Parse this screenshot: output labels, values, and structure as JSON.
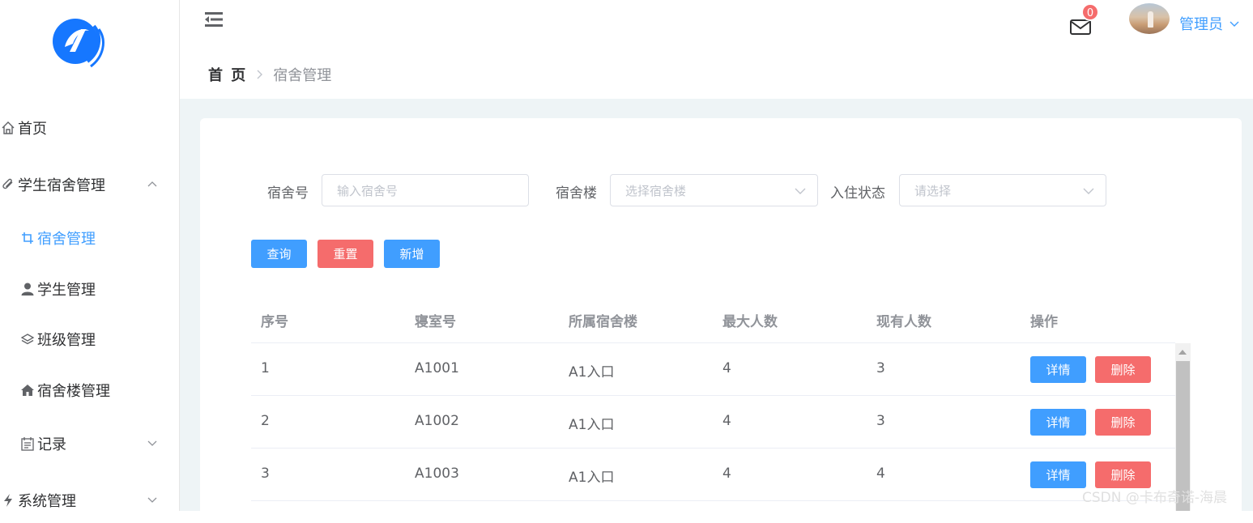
{
  "sidebar": {
    "items": [
      {
        "label": "首页",
        "icon": "home-icon"
      },
      {
        "label": "学生宿舍管理",
        "icon": "paperclip-icon",
        "expanded": true
      },
      {
        "label": "宿舍管理",
        "icon": "crop-icon",
        "active": true
      },
      {
        "label": "学生管理",
        "icon": "user-icon"
      },
      {
        "label": "班级管理",
        "icon": "layers-icon"
      },
      {
        "label": "宿舍楼管理",
        "icon": "house-icon"
      },
      {
        "label": "记录",
        "icon": "calendar-icon",
        "expanded": false
      },
      {
        "label": "系统管理",
        "icon": "lightning-icon",
        "expanded": false
      }
    ]
  },
  "header": {
    "mail_count": "0",
    "user_name": "管理员",
    "breadcrumb": {
      "home": "首 页",
      "current": "宿舍管理"
    }
  },
  "filters": {
    "room_label": "宿舍号",
    "room_placeholder": "输入宿舍号",
    "building_label": "宿舍楼",
    "building_placeholder": "选择宿舍楼",
    "status_label": "入住状态",
    "status_placeholder": "请选择"
  },
  "actions": {
    "query": "查询",
    "reset": "重置",
    "add": "新增"
  },
  "table": {
    "headers": [
      "序号",
      "寝室号",
      "所属宿舍楼",
      "最大人数",
      "现有人数",
      "操作"
    ],
    "rows": [
      {
        "index": "1",
        "room": "A1001",
        "building": "A1入口",
        "max": "4",
        "current": "3"
      },
      {
        "index": "2",
        "room": "A1002",
        "building": "A1入口",
        "max": "4",
        "current": "3"
      },
      {
        "index": "3",
        "room": "A1003",
        "building": "A1入口",
        "max": "4",
        "current": "4"
      }
    ],
    "detail_label": "详情",
    "delete_label": "删除"
  },
  "watermark": "CSDN @卡布奇诺-海晨",
  "colors": {
    "primary": "#409eff",
    "danger": "#f56c6c",
    "background": "#eef4f6"
  }
}
